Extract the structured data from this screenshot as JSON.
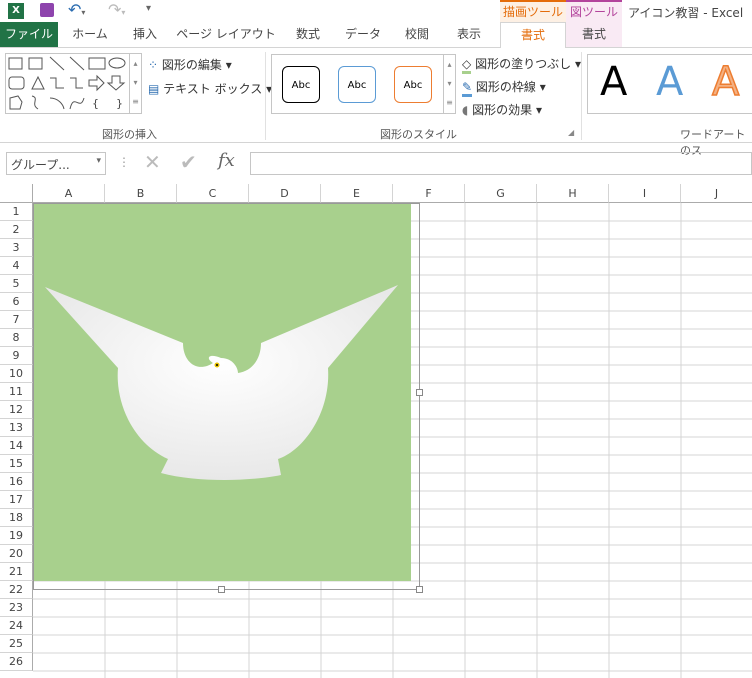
{
  "window": {
    "title": "アイコン教習 - Excel"
  },
  "tool_tabs": {
    "drawing_tools": "描画ツール",
    "picture_tools": "図ツール"
  },
  "tabs": [
    "ファイル",
    "ホーム",
    "挿入",
    "ページ レイアウト",
    "数式",
    "データ",
    "校閲",
    "表示",
    "書式",
    "書式"
  ],
  "ribbon": {
    "insert_shapes": {
      "label": "図形の挿入",
      "edit_shape": "図形の編集",
      "text_box": "テキスト ボックス"
    },
    "shape_styles": {
      "label": "図形のスタイル",
      "sample": "Abc",
      "fill": "図形の塗りつぶし",
      "outline": "図形の枠線",
      "effects": "図形の効果"
    },
    "wordart": {
      "label": "ワードアートのス",
      "sample": "A"
    }
  },
  "formula_bar": {
    "name_box": "グループ...",
    "fx": "fx",
    "value": ""
  },
  "columns": [
    "A",
    "B",
    "C",
    "D",
    "E",
    "F",
    "G",
    "H",
    "I",
    "J"
  ],
  "rows": [
    "1",
    "2",
    "3",
    "4",
    "5",
    "6",
    "7",
    "8",
    "9",
    "10",
    "11",
    "12",
    "13",
    "14",
    "15",
    "16",
    "17",
    "18",
    "19",
    "20",
    "21",
    "22",
    "23",
    "24",
    "25",
    "26"
  ],
  "colors": {
    "excel_green": "#217346",
    "drawing_tools": "#e46c0a",
    "picture_tools": "#b3449c",
    "image_bg": "#a8d08d"
  }
}
